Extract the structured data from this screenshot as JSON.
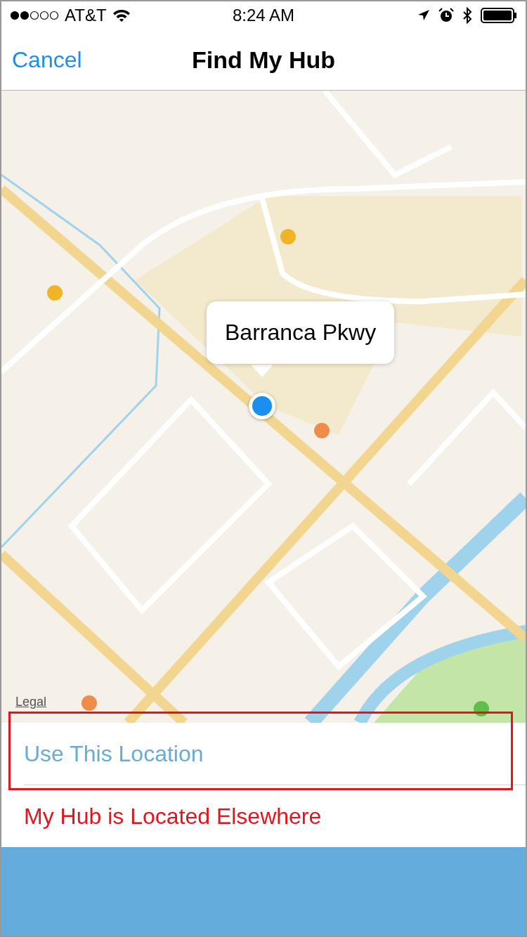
{
  "status_bar": {
    "carrier": "AT&T",
    "time": "8:24 AM"
  },
  "nav": {
    "cancel": "Cancel",
    "title": "Find My Hub"
  },
  "map": {
    "callout": "Barranca Pkwy",
    "legal": "Legal"
  },
  "actions": [
    {
      "label": "Use This Location",
      "kind": "primary",
      "highlighted": true
    },
    {
      "label": "My Hub is Located Elsewhere",
      "kind": "destructive",
      "highlighted": false
    }
  ]
}
